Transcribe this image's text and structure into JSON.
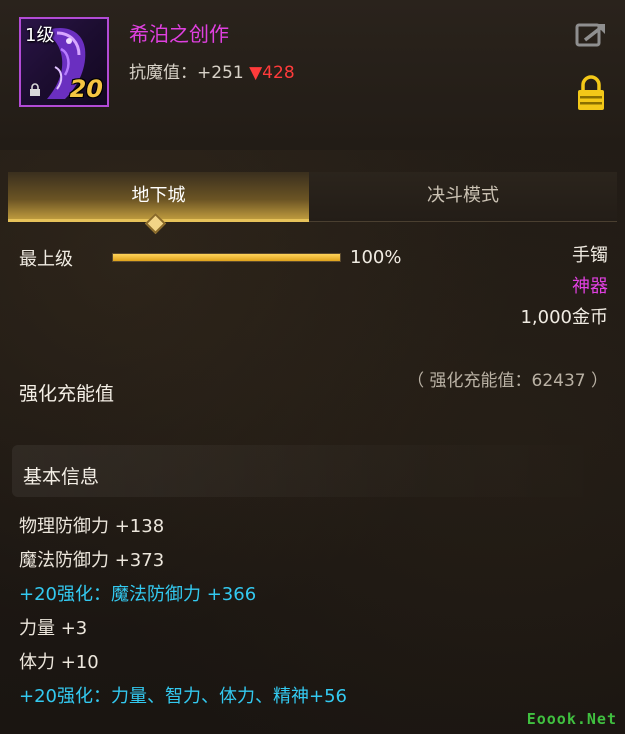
{
  "item": {
    "level": "1级",
    "enhance": "20",
    "name": "希泊之创作",
    "stat_label": "抗魔值：+251",
    "stat_drop": "▼428",
    "name_color": "#e040e0"
  },
  "icons": {
    "export": "export-icon",
    "lock": "lock-icon",
    "item_lock": "small-lock-icon"
  },
  "tabs": [
    {
      "label": "地下城",
      "active": true
    },
    {
      "label": "决斗模式",
      "active": false
    }
  ],
  "grade": {
    "label": "最上级",
    "percent_text": "100%",
    "fill": 1.0
  },
  "info": {
    "slot": "手镯",
    "rarity": "神器",
    "price": "1,000金币"
  },
  "charge": {
    "title": "强化充能值",
    "note": "（ 强化充能值：62437 ）"
  },
  "basic": {
    "title": "基本信息",
    "stats": [
      {
        "text": "物理防御力 +138",
        "kind": "normal"
      },
      {
        "text": "魔法防御力 +373",
        "kind": "normal"
      },
      {
        "text": "+20强化：魔法防御力 +366",
        "kind": "enh"
      },
      {
        "text": "力量 +3",
        "kind": "normal"
      },
      {
        "text": "体力 +10",
        "kind": "normal"
      },
      {
        "text": "+20强化：力量、智力、体力、精神+56",
        "kind": "enh"
      }
    ]
  },
  "watermark": "Eoook.Net"
}
